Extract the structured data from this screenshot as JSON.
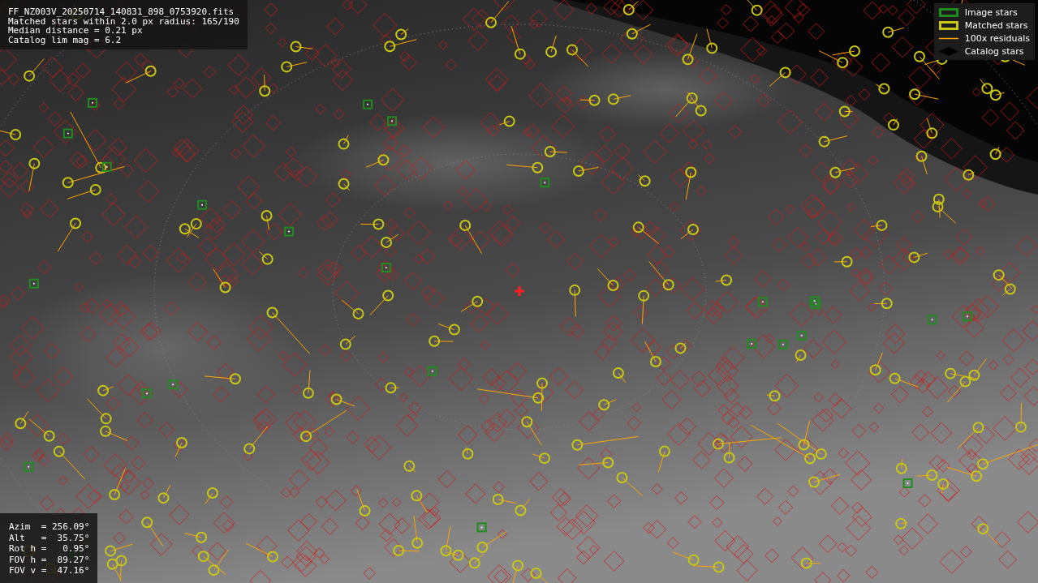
{
  "info_panel": {
    "lines": [
      "FF_NZ003V_20250714_140831_898_0753920.fits",
      "Matched stars within 2.0 px radius: 165/190",
      "Median distance = 0.21 px",
      "Catalog lim mag = 6.2"
    ]
  },
  "legend": [
    {
      "kind": "box",
      "color": "#1e8c1e",
      "label": "Image stars"
    },
    {
      "kind": "box",
      "color": "#c8c814",
      "label": "Matched stars"
    },
    {
      "kind": "line",
      "color": "#ffa500",
      "label": "100x residuals"
    },
    {
      "kind": "diamond",
      "color": "#000000",
      "label": "Catalog stars"
    }
  ],
  "pointing_panel": {
    "lines": [
      "Azim  = 256.09°",
      "Alt   =  35.75°",
      "Rot h =   0.95°",
      "FOV h =  89.27°",
      "FOV v =  47.16°"
    ]
  }
}
